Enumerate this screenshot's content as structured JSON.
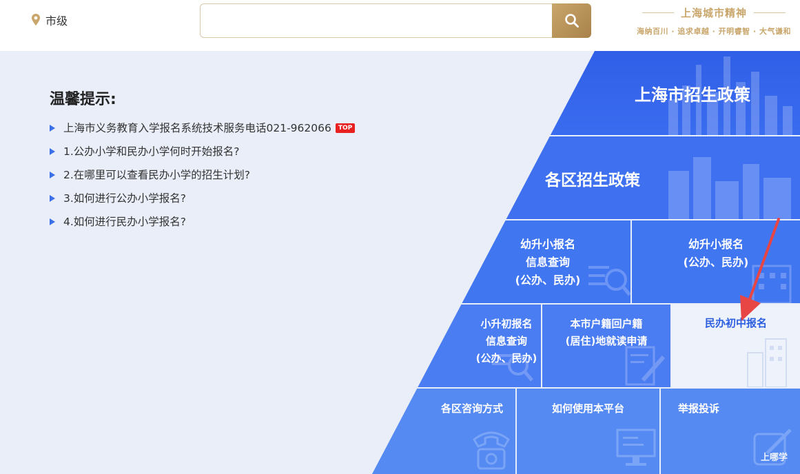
{
  "header": {
    "location_label": "市级",
    "search_placeholder": "",
    "slogan_title": "上海城市精神",
    "slogan_sub": "海纳百川 · 追求卓越 · 开明睿智 · 大气谦和"
  },
  "tips": {
    "title": "温馨提示:",
    "items": [
      {
        "text": "上海市义务教育入学报名系统技术服务电话021-962066",
        "badge": "TOP"
      },
      {
        "text": "1.公办小学和民办小学何时开始报名?"
      },
      {
        "text": "2.在哪里可以查看民办小学的招生计划?"
      },
      {
        "text": "3.如何进行公办小学报名?"
      },
      {
        "text": "4.如何进行民办小学报名?"
      }
    ]
  },
  "tiles": {
    "policy_city": "上海市招生政策",
    "policy_district": "各区招生政策",
    "k2p_query": [
      "幼升小报名",
      "信息查询",
      "(公办、民办)"
    ],
    "k2p_signup": [
      "幼升小报名",
      "(公办、民办)"
    ],
    "p2m_query": [
      "小升初报名",
      "信息查询",
      "(公办、民办)"
    ],
    "household": [
      "本市户籍回户籍",
      "(居住)地就读申请"
    ],
    "private_middle": "民办初中报名",
    "contact": "各区咨询方式",
    "howto": "如何使用本平台",
    "report": "举报投诉"
  },
  "watermark": "上哪学",
  "colors": {
    "accent_gold": "#c9a66b",
    "tile_blue": "#3d6ff0",
    "arrow_red": "#e84545",
    "bullet_blue": "#3b6fe8"
  }
}
